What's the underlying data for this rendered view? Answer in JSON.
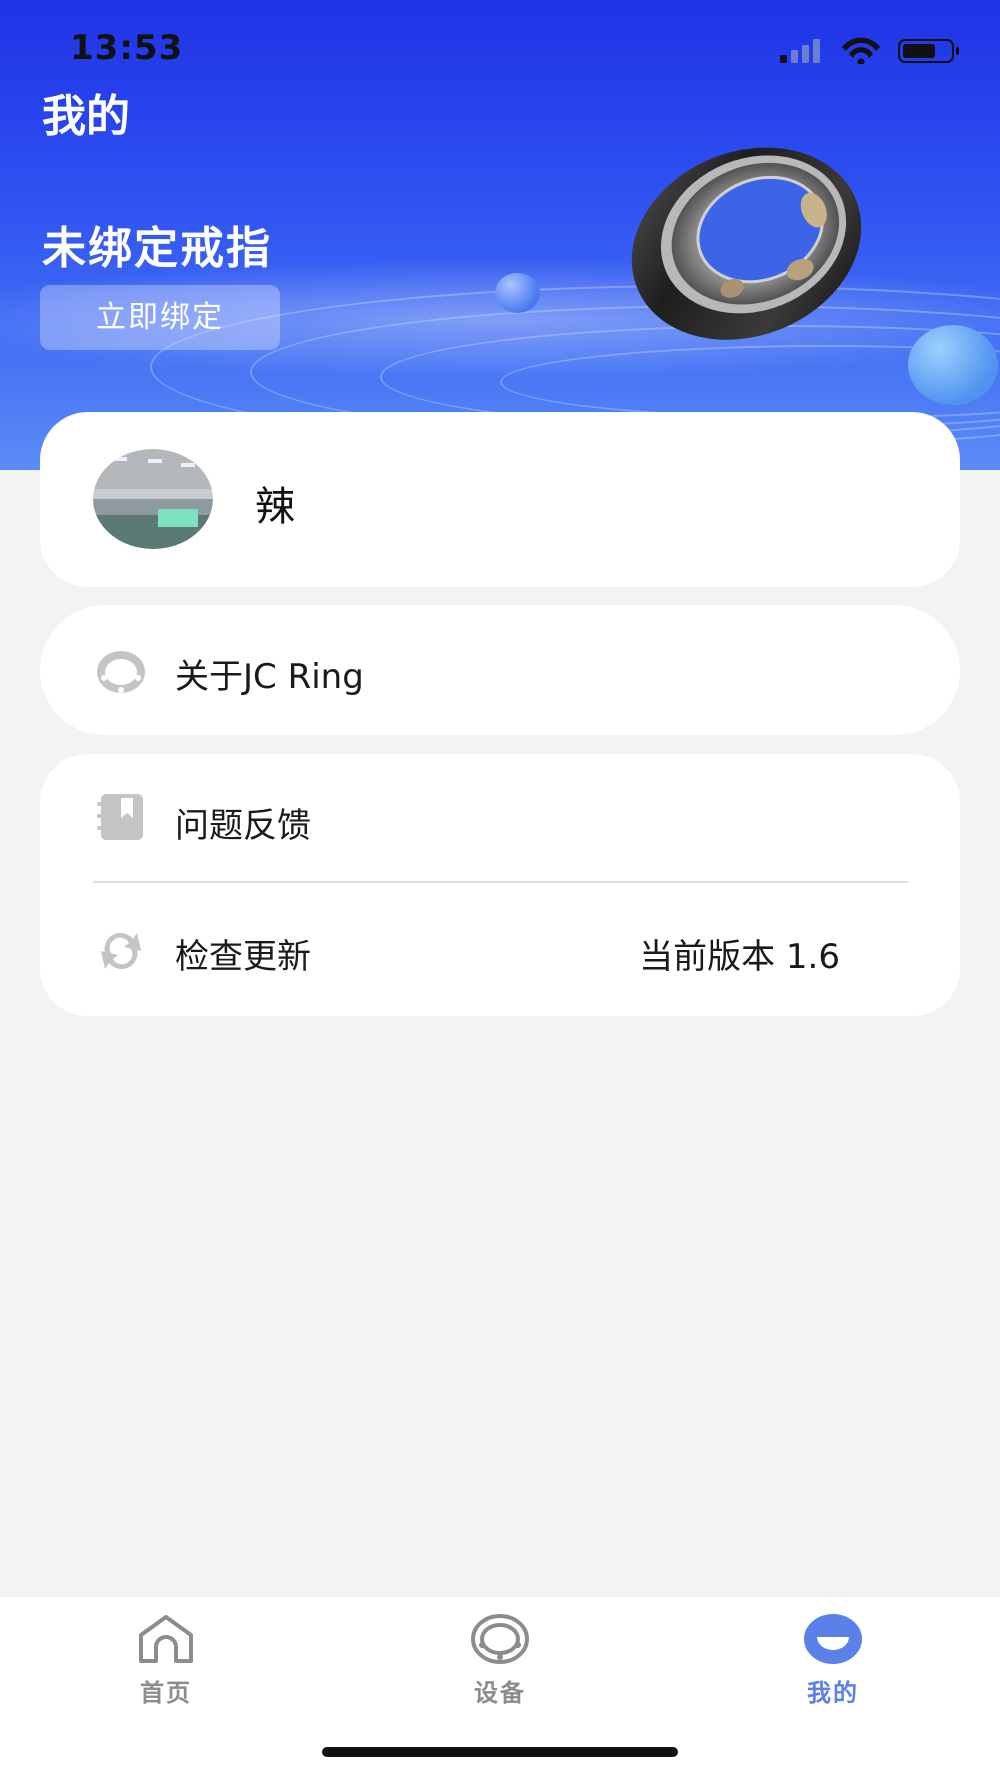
{
  "status_bar": {
    "time": "13:53"
  },
  "header": {
    "title": "我的",
    "bind_status": "未绑定戒指",
    "bind_button_label": "立即绑定"
  },
  "profile": {
    "name": "辣"
  },
  "menu": {
    "about_label": "关于JC Ring",
    "feedback_label": "问题反馈",
    "update_label": "检查更新",
    "version_text": "当前版本 1.6"
  },
  "tabs": [
    {
      "label": "首页",
      "icon": "home-icon",
      "active": false
    },
    {
      "label": "设备",
      "icon": "ring-icon",
      "active": false
    },
    {
      "label": "我的",
      "icon": "profile-face-icon",
      "active": true
    }
  ],
  "colors": {
    "hero_top": "#1f33e6",
    "hero_bottom": "#5b8cf6",
    "accent": "#5b80e8",
    "icon_gray": "#c4c4c4"
  }
}
